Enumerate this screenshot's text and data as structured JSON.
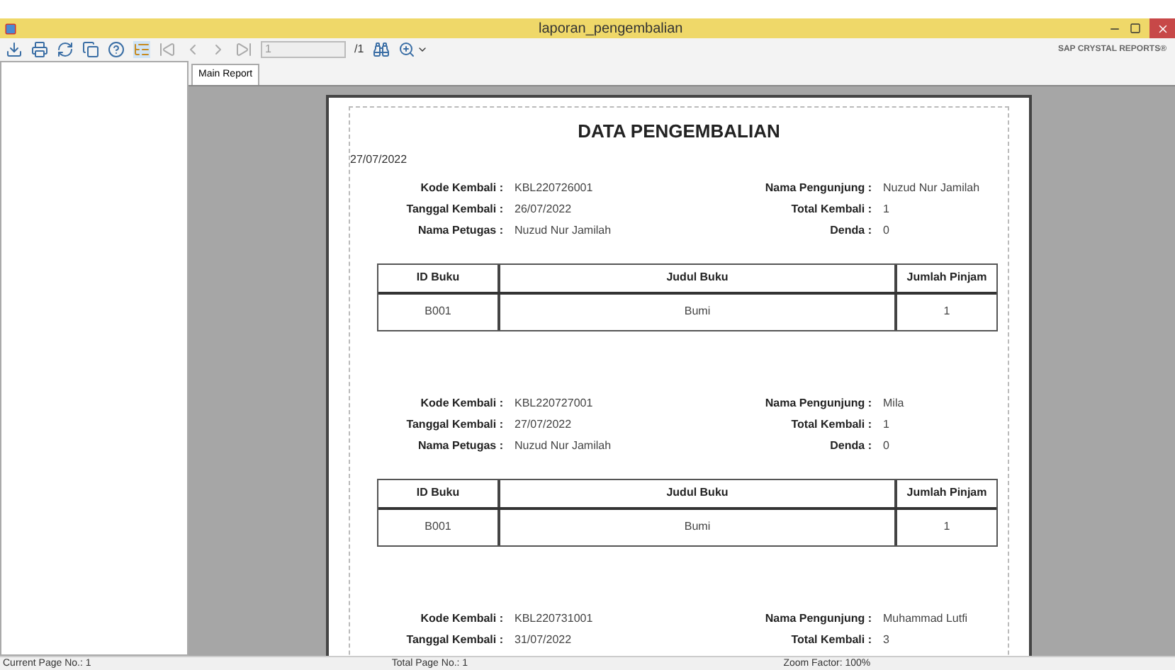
{
  "window": {
    "title": "laporan_pengembalian"
  },
  "toolbar": {
    "page_input": "1",
    "page_total": "/1",
    "brand": "SAP CRYSTAL REPORTS®"
  },
  "tabs": [
    {
      "label": "Main Report",
      "selected": true
    }
  ],
  "report": {
    "title": "DATA PENGEMBALIAN",
    "date": "27/07/2022",
    "records": [
      {
        "left": [
          {
            "label": "Kode Kembali :",
            "value": "KBL220726001"
          },
          {
            "label": "Tanggal Kembali :",
            "value": "26/07/2022"
          },
          {
            "label": "Nama Petugas :",
            "value": "Nuzud Nur Jamilah"
          }
        ],
        "right": [
          {
            "label": "Nama Pengunjung :",
            "value": "Nuzud Nur Jamilah"
          },
          {
            "label": "Total Kembali :",
            "value": "1"
          },
          {
            "label": "Denda :",
            "value": "0"
          }
        ],
        "table": {
          "columns": [
            "ID Buku",
            "Judul Buku",
            "Jumlah Pinjam"
          ],
          "rows": [
            [
              "B001",
              "Bumi",
              "1"
            ]
          ]
        }
      },
      {
        "left": [
          {
            "label": "Kode Kembali :",
            "value": "KBL220727001"
          },
          {
            "label": "Tanggal Kembali :",
            "value": "27/07/2022"
          },
          {
            "label": "Nama Petugas :",
            "value": "Nuzud Nur Jamilah"
          }
        ],
        "right": [
          {
            "label": "Nama Pengunjung :",
            "value": "Mila"
          },
          {
            "label": "Total Kembali :",
            "value": "1"
          },
          {
            "label": "Denda :",
            "value": "0"
          }
        ],
        "table": {
          "columns": [
            "ID Buku",
            "Judul Buku",
            "Jumlah Pinjam"
          ],
          "rows": [
            [
              "B001",
              "Bumi",
              "1"
            ]
          ]
        }
      },
      {
        "left": [
          {
            "label": "Kode Kembali :",
            "value": "KBL220731001"
          },
          {
            "label": "Tanggal Kembali :",
            "value": "31/07/2022"
          }
        ],
        "right": [
          {
            "label": "Nama Pengunjung :",
            "value": "Muhammad Lutfi"
          },
          {
            "label": "Total Kembali :",
            "value": "3"
          }
        ]
      }
    ]
  },
  "status_bar": [
    "Current Page No.: 1",
    "Total Page No.: 1",
    "Zoom Factor: 100%"
  ]
}
